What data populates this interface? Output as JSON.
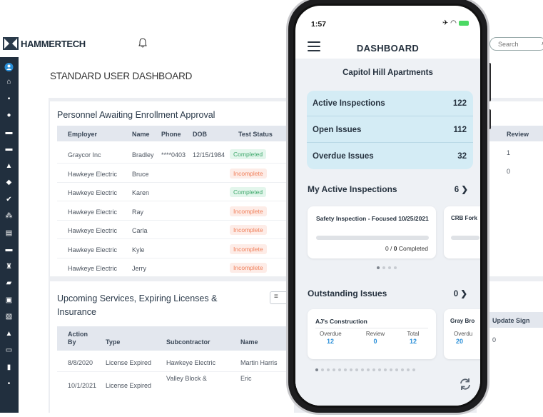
{
  "app": {
    "brand": "HAMMERTECH",
    "search_placeholder": "Search",
    "page_title": "STANDARD USER DASHBOARD",
    "accent": "#2a8fd8",
    "sidebar_color": "#212f3e"
  },
  "enrollment": {
    "title": "Personnel Awaiting Enrollment Approval",
    "columns": [
      "Employer",
      "Name",
      "Phone",
      "DOB",
      "Test Status"
    ],
    "rows": [
      {
        "employer": "Graycor Inc",
        "name": "Bradley",
        "phone": "****0403",
        "dob": "12/15/1984",
        "status": "Completed"
      },
      {
        "employer": "Hawkeye Electric",
        "name": "Bruce",
        "phone": "",
        "dob": "",
        "status": "Incomplete"
      },
      {
        "employer": "Hawkeye Electric",
        "name": "Karen",
        "phone": "",
        "dob": "",
        "status": "Completed"
      },
      {
        "employer": "Hawkeye Electric",
        "name": "Ray",
        "phone": "",
        "dob": "",
        "status": "Incomplete"
      },
      {
        "employer": "Hawkeye Electric",
        "name": "Carla",
        "phone": "",
        "dob": "",
        "status": "Incomplete"
      },
      {
        "employer": "Hawkeye Electric",
        "name": "Kyle",
        "phone": "",
        "dob": "",
        "status": "Incomplete"
      },
      {
        "employer": "Hawkeye Electric",
        "name": "Jerry",
        "phone": "",
        "dob": "",
        "status": "Incomplete"
      }
    ]
  },
  "review_panel": {
    "column": "Review",
    "values": [
      "1",
      "0"
    ]
  },
  "services": {
    "title_line1": "Upcoming Services, Expiring Licenses &",
    "title_line2": "Insurance",
    "columns": [
      "Action By",
      "Type",
      "Subcontractor",
      "Name"
    ],
    "rows": [
      {
        "action_by": "8/8/2020",
        "type": "License Expired",
        "subcontractor": "Hawkeye Electric",
        "name": "Martin Harris"
      },
      {
        "action_by": "10/1/2021",
        "type": "License Expired",
        "subcontractor": "Valley Block &",
        "name": "Eric"
      }
    ]
  },
  "update_panel": {
    "column": "Update Sign",
    "values": [
      "0"
    ]
  },
  "phone": {
    "time": "1:57",
    "title": "DASHBOARD",
    "project": "Capitol Hill Apartments",
    "stats": [
      {
        "label": "Active Inspections",
        "value": "122"
      },
      {
        "label": "Open Issues",
        "value": "112"
      },
      {
        "label": "Overdue Issues",
        "value": "32"
      }
    ],
    "active_inspections": {
      "label": "My Active Inspections",
      "count": "6",
      "card_title": "Safety Inspection - Focused 10/25/2021",
      "progress": 0,
      "progress_done": "0",
      "progress_total": "0",
      "progress_suffix": "Completed",
      "next_card_title": "CRB Fork"
    },
    "outstanding_issues": {
      "label": "Outstanding Issues",
      "count": "0",
      "card_title": "AJ's Construction",
      "overdue_label": "Overdue",
      "overdue_value": "12",
      "review_label": "Review",
      "review_value": "0",
      "total_label": "Total",
      "total_value": "12",
      "next_card_title": "Gray Bro",
      "next_overdue_label": "Overdu",
      "next_overdue_value": "20"
    },
    "accent_value_color": "#2a8fd8"
  }
}
